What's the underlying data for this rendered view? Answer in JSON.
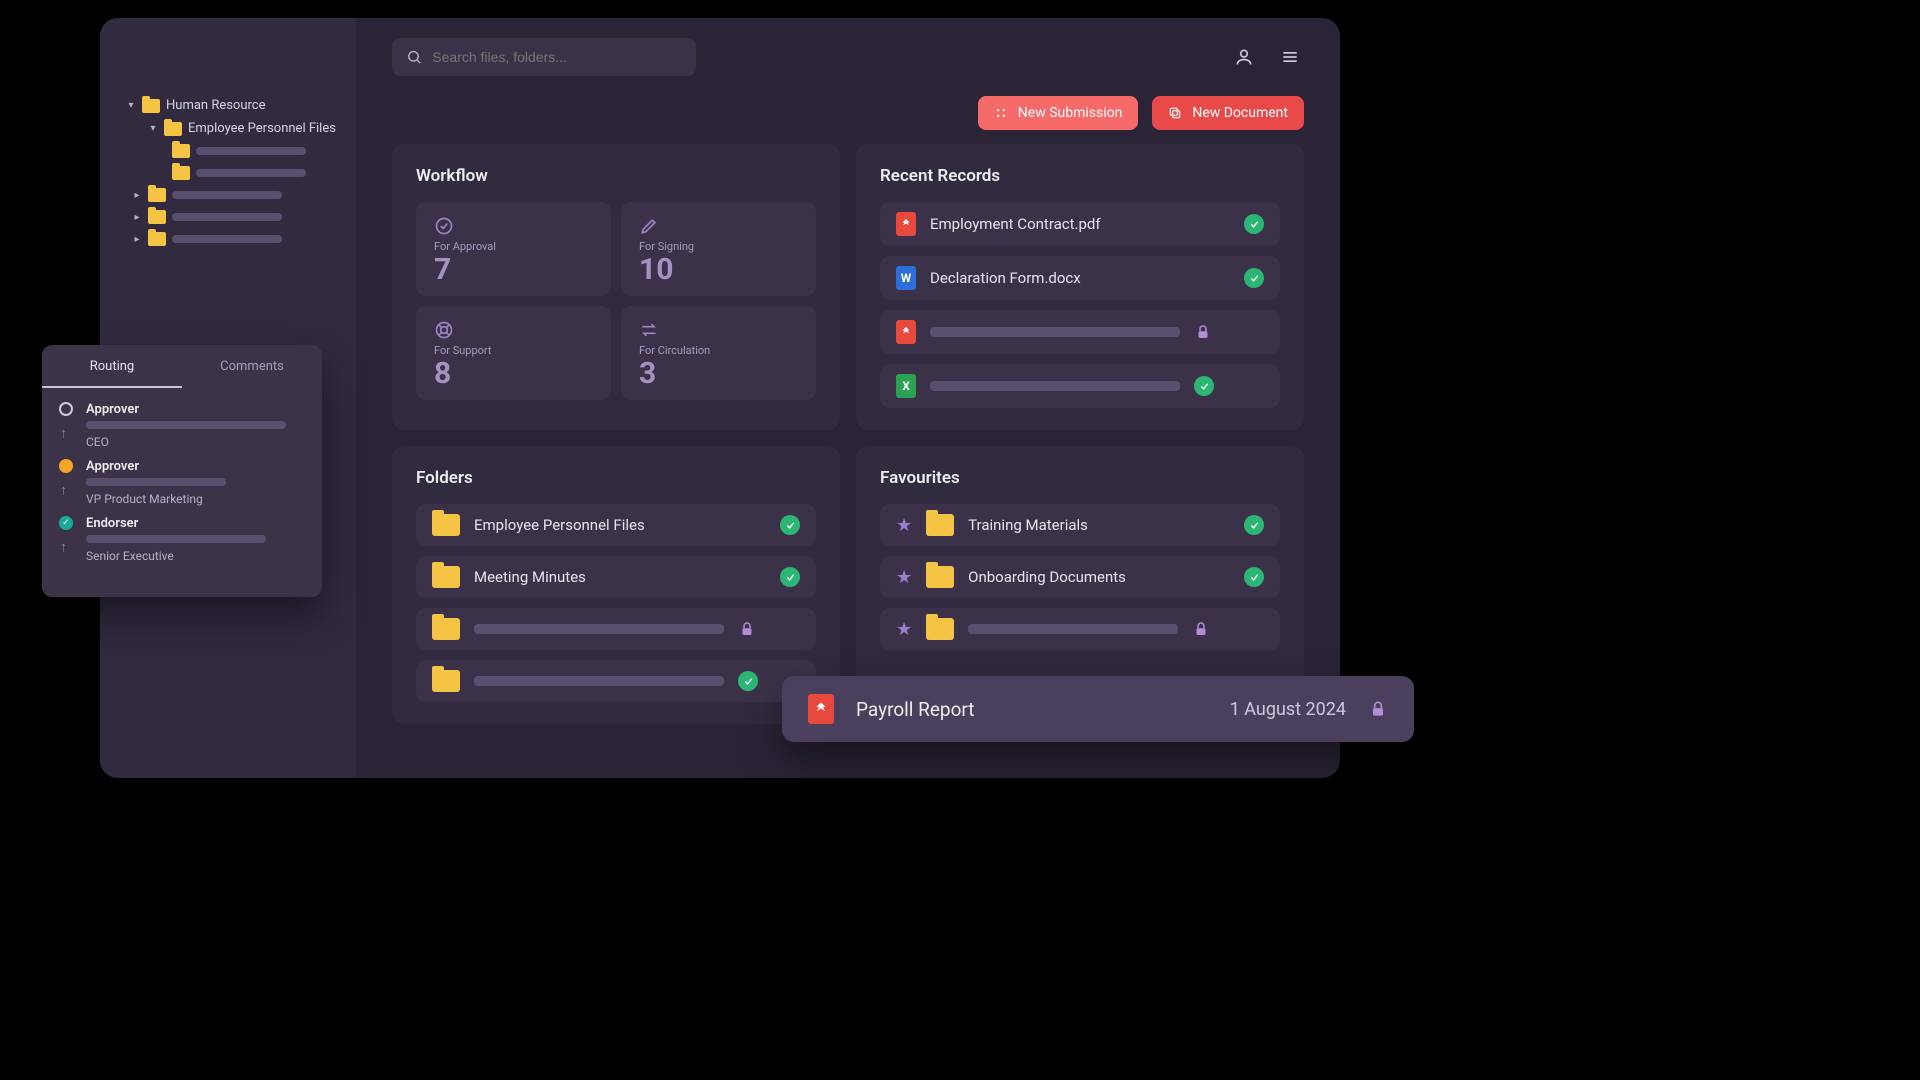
{
  "sidebar": {
    "tree": {
      "root_label": "Human Resource",
      "child_label": "Employee Personnel Files"
    }
  },
  "search": {
    "placeholder": "Search files, folders..."
  },
  "actions": {
    "new_submission": "New Submission",
    "new_document": "New Document"
  },
  "workflow": {
    "title": "Workflow",
    "cards": [
      {
        "label": "For Approval",
        "value": "7"
      },
      {
        "label": "For Signing",
        "value": "10"
      },
      {
        "label": "For Support",
        "value": "8"
      },
      {
        "label": "For Circulation",
        "value": "3"
      }
    ]
  },
  "recent": {
    "title": "Recent Records",
    "items": [
      {
        "name": "Employment Contract.pdf",
        "type": "pdf",
        "status": "ok"
      },
      {
        "name": "Declaration Form.docx",
        "type": "docx",
        "status": "ok"
      },
      {
        "name": "",
        "type": "pdf",
        "status": "locked"
      },
      {
        "name": "",
        "type": "xlsx",
        "status": "ok"
      }
    ]
  },
  "folders": {
    "title": "Folders",
    "items": [
      {
        "name": "Employee Personnel Files",
        "status": "ok"
      },
      {
        "name": "Meeting Minutes",
        "status": "ok"
      },
      {
        "name": "",
        "status": "locked"
      },
      {
        "name": "",
        "status": "ok"
      }
    ]
  },
  "favourites": {
    "title": "Favourites",
    "items": [
      {
        "name": "Training Materials",
        "status": "ok"
      },
      {
        "name": "Onboarding Documents",
        "status": "ok"
      },
      {
        "name": "",
        "status": "locked"
      }
    ]
  },
  "routing": {
    "tabs": {
      "routing": "Routing",
      "comments": "Comments"
    },
    "steps": [
      {
        "role": "Approver",
        "who": "CEO",
        "dot": "open"
      },
      {
        "role": "Approver",
        "who": "VP Product Marketing",
        "dot": "orange"
      },
      {
        "role": "Endorser",
        "who": "Senior Executive",
        "dot": "teal"
      }
    ]
  },
  "payroll": {
    "name": "Payroll Report",
    "date": "1 August 2024"
  }
}
